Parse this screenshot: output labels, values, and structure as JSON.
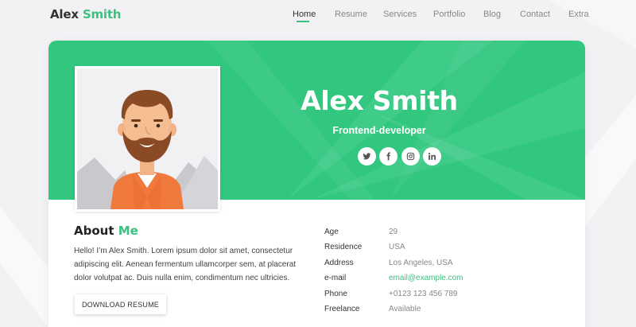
{
  "header": {
    "logo_first": "Alex",
    "logo_second": "Smith",
    "nav": [
      {
        "label": "Home",
        "active": true
      },
      {
        "label": "Resume"
      },
      {
        "label": "Services"
      },
      {
        "label": "Portfolio"
      },
      {
        "label": "Blog"
      },
      {
        "label": "Contact"
      },
      {
        "label": "Extra"
      }
    ]
  },
  "hero": {
    "name": "Alex Smith",
    "title": "Frontend-developer",
    "socials": [
      {
        "icon": "twitter-icon"
      },
      {
        "icon": "facebook-icon"
      },
      {
        "icon": "instagram-icon"
      },
      {
        "icon": "linkedin-icon"
      }
    ]
  },
  "about": {
    "heading_first": "About",
    "heading_second": "Me",
    "text": "Hello! I’m Alex Smith. Lorem ipsum dolor sit amet, consectetur adipiscing elit. Aenean fermentum ullamcorper sem, at placerat dolor volutpat ac. Duis nulla enim, condimentum nec ultricies.",
    "download_label": "DOWNLOAD RESUME"
  },
  "info": [
    {
      "label": "Age",
      "value": "29"
    },
    {
      "label": "Residence",
      "value": "USA"
    },
    {
      "label": "Address",
      "value": "Los Angeles, USA"
    },
    {
      "label": "e-mail",
      "value": "email@example.com"
    },
    {
      "label": "Phone",
      "value": "+0123 123 456 789"
    },
    {
      "label": "Freelance",
      "value": "Available"
    }
  ],
  "colors": {
    "accent": "#3dbf7f",
    "hero_bg": "#31c77f",
    "page_bg": "#f2f2f5"
  }
}
